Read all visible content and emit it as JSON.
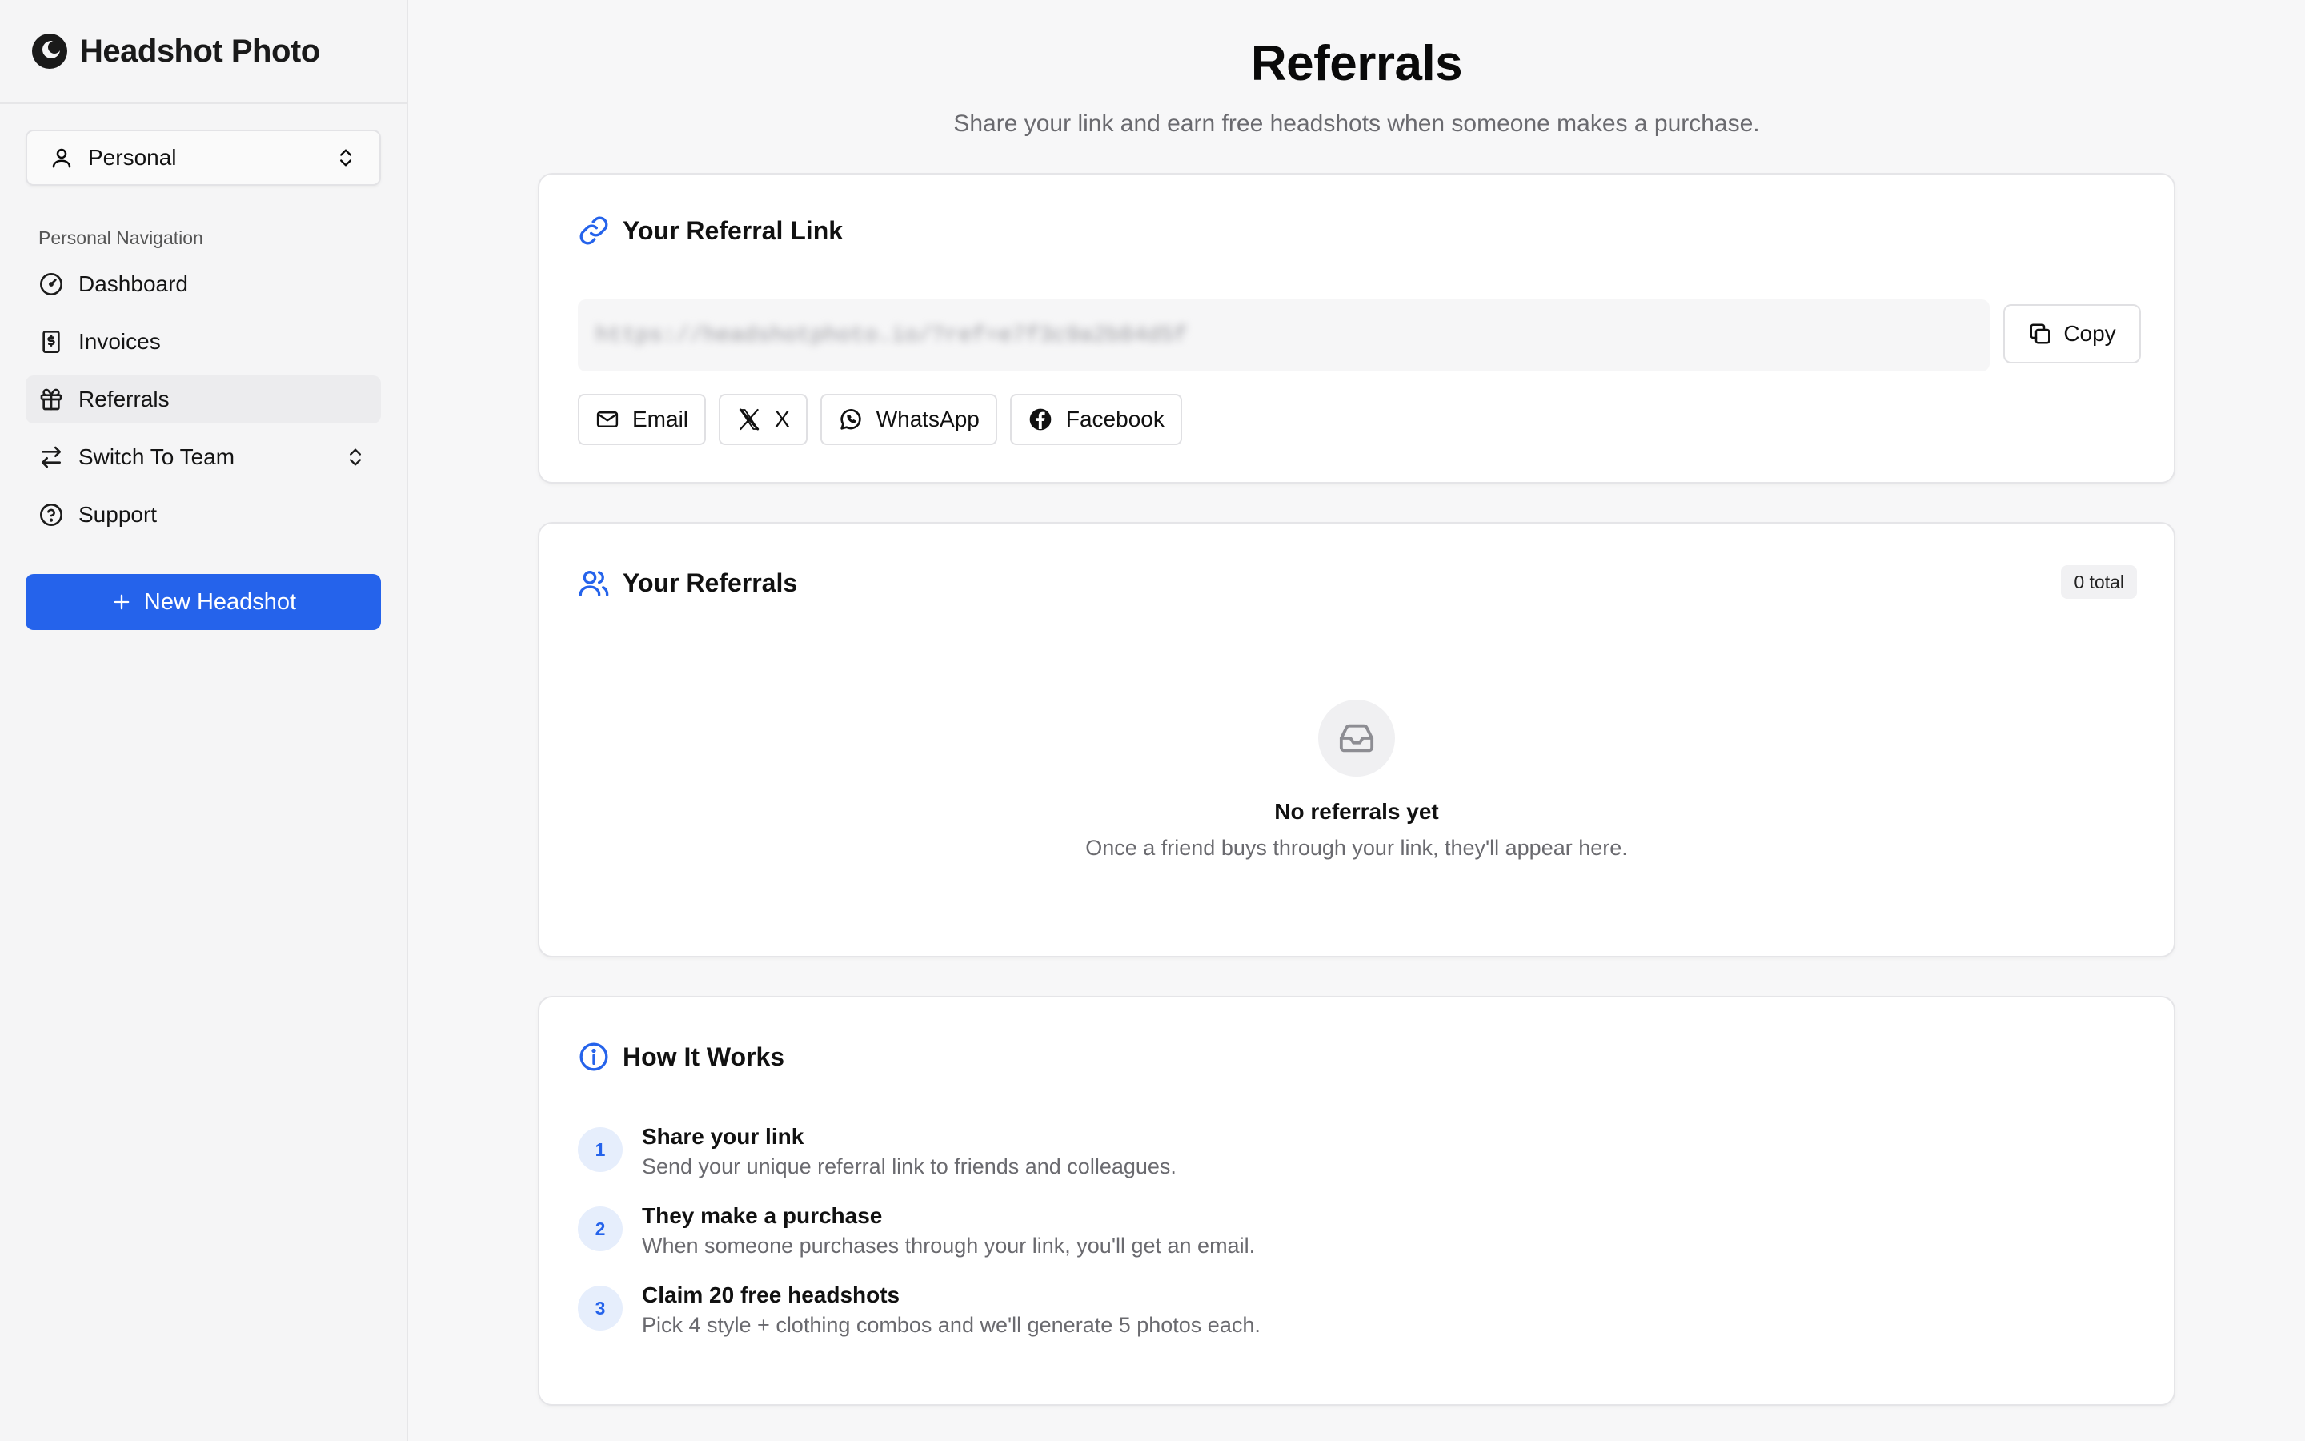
{
  "brand": {
    "name": "Headshot Photo"
  },
  "workspace": {
    "label": "Personal"
  },
  "nav": {
    "section_title": "Personal Navigation",
    "items": [
      {
        "label": "Dashboard",
        "icon": "gauge-icon"
      },
      {
        "label": "Invoices",
        "icon": "receipt-icon"
      },
      {
        "label": "Referrals",
        "icon": "gift-icon",
        "active": true
      },
      {
        "label": "Switch To Team",
        "icon": "arrows-swap-icon"
      },
      {
        "label": "Support",
        "icon": "help-circle-icon"
      }
    ],
    "new_button": "New Headshot"
  },
  "page": {
    "title": "Referrals",
    "subtitle": "Share your link and earn free headshots when someone makes a purchase."
  },
  "referral_link": {
    "title": "Your Referral Link",
    "value": "https://headshotphoto.io/?ref=e7f3c9a2b84d5f",
    "copy_label": "Copy",
    "share": {
      "email": "Email",
      "x": "X",
      "whatsapp": "WhatsApp",
      "facebook": "Facebook"
    }
  },
  "referrals": {
    "title": "Your Referrals",
    "count_label": "0 total",
    "empty_title": "No referrals yet",
    "empty_desc": "Once a friend buys through your link, they'll appear here."
  },
  "how": {
    "title": "How It Works",
    "steps": [
      {
        "num": "1",
        "title": "Share your link",
        "desc": "Send your unique referral link to friends and colleagues."
      },
      {
        "num": "2",
        "title": "They make a purchase",
        "desc": "When someone purchases through your link, you'll get an email."
      },
      {
        "num": "3",
        "title": "Claim 20 free headshots",
        "desc": "Pick 4 style + clothing combos and we'll generate 5 photos each."
      }
    ]
  },
  "colors": {
    "accent": "#2563eb",
    "sidebar_bg": "#f5f5f6",
    "page_bg": "#f7f7f8"
  }
}
